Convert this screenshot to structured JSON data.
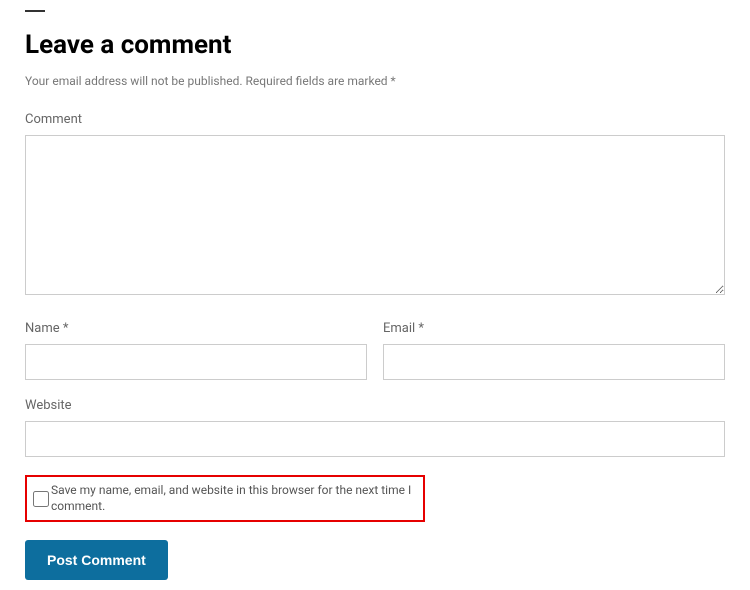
{
  "heading": "Leave a comment",
  "notice": "Your email address will not be published. Required fields are marked *",
  "fields": {
    "comment": {
      "label": "Comment",
      "value": ""
    },
    "name": {
      "label": "Name *",
      "value": ""
    },
    "email": {
      "label": "Email *",
      "value": ""
    },
    "website": {
      "label": "Website",
      "value": ""
    }
  },
  "consent": {
    "label": "Save my name, email, and website in this browser for the next time I comment.",
    "checked": false
  },
  "submit": {
    "label": "Post Comment"
  }
}
